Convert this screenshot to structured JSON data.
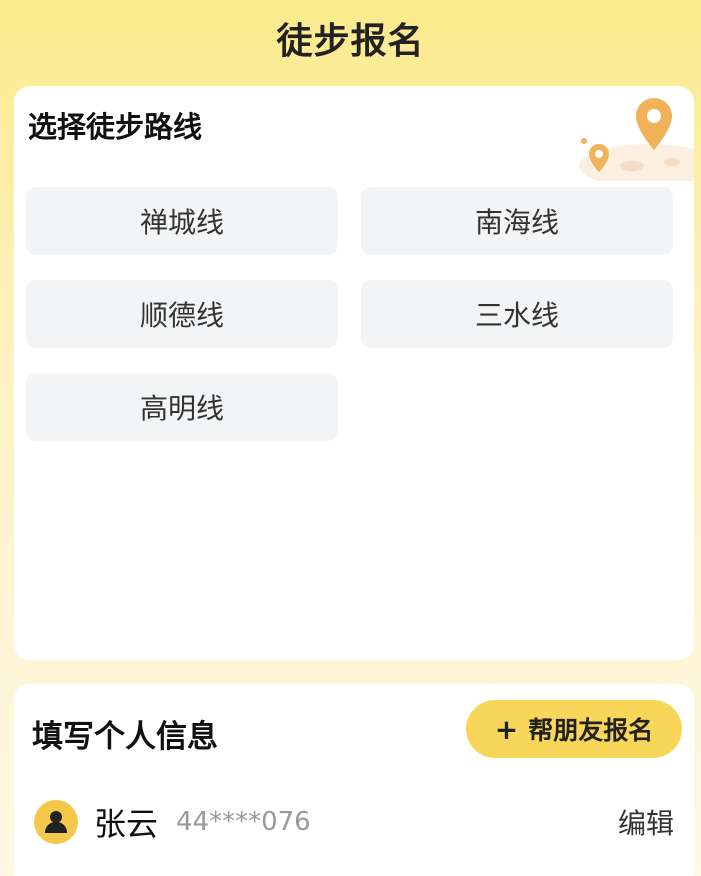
{
  "header": {
    "title": "徒步报名"
  },
  "route_section": {
    "title": "选择徒步路线",
    "routes": [
      {
        "label": "禅城线"
      },
      {
        "label": "南海线"
      },
      {
        "label": "顺德线"
      },
      {
        "label": "三水线"
      },
      {
        "label": "高明线"
      }
    ]
  },
  "info_section": {
    "title": "填写个人信息",
    "help_button": {
      "icon": "plus-icon",
      "label": "帮朋友报名"
    },
    "person": {
      "avatar_icon": "user-icon",
      "name": "张云",
      "id_masked": "44****076",
      "edit_label": "编辑"
    }
  },
  "colors": {
    "header_bg": "#fbe98b",
    "accent": "#f8d65a",
    "route_bg": "#f3f4f5",
    "avatar_bg": "#f4c84a",
    "pin": "#f1b25a"
  }
}
